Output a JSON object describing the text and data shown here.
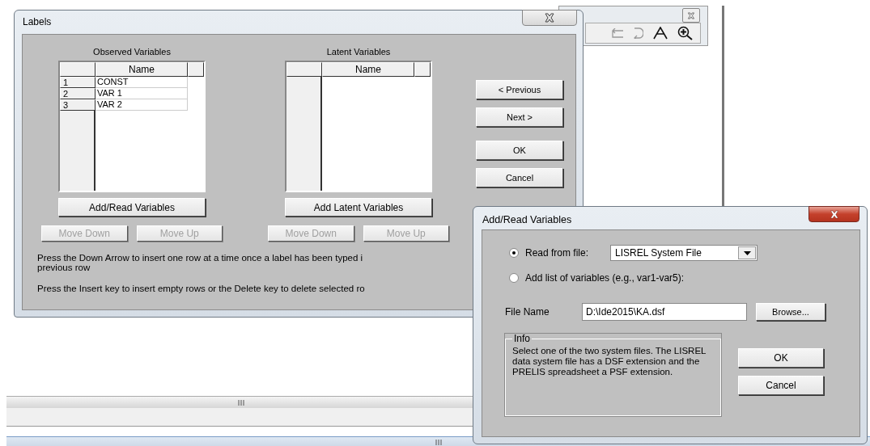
{
  "labels_dialog": {
    "title": "Labels",
    "panels": [
      {
        "heading": "Observed Variables",
        "columns": [
          "Name"
        ],
        "rows": [
          {
            "number": "1",
            "name": "CONST"
          },
          {
            "number": "2",
            "name": "VAR 1"
          },
          {
            "number": "3",
            "name": "VAR 2"
          }
        ],
        "add_button": "Add/Read Variables",
        "move_buttons": [
          {
            "label": "Move Down",
            "disabled": true
          },
          {
            "label": "Move Up",
            "disabled": true
          }
        ]
      },
      {
        "heading": "Latent Variables",
        "columns": [
          "Name"
        ],
        "add_button": "Add Latent Variables",
        "move_buttons": [
          {
            "label": "Move Down",
            "disabled": true
          },
          {
            "label": "Move Up",
            "disabled": true
          }
        ]
      }
    ],
    "nav_buttons": [
      "< Previous",
      "Next >",
      "OK",
      "Cancel"
    ],
    "hints": [
      {
        "lines": [
          "Press the Down Arrow to insert one row at a time once a label has been typed i",
          "previous row"
        ]
      },
      {
        "lines": [
          "Press the Insert key to insert empty rows or the Delete key to delete selected ro"
        ]
      }
    ]
  },
  "add_read_dialog": {
    "title": "Add/Read Variables",
    "sources": [
      {
        "label": "Read from file:",
        "selected": true
      },
      {
        "label": "Add list of variables (e.g., var1-var5):",
        "selected": false
      }
    ],
    "file_type": "LISREL System File",
    "file_name_label": "File Name",
    "file_name": "D:\\Ide2015\\KA.dsf",
    "browse_button": "Browse...",
    "info": {
      "title": "Info",
      "text": "Select one of the two system files. The LISREL data system file has a DSF extension and the PRELIS spreadsheet a PSF extension."
    },
    "buttons": [
      "OK",
      "Cancel"
    ]
  }
}
